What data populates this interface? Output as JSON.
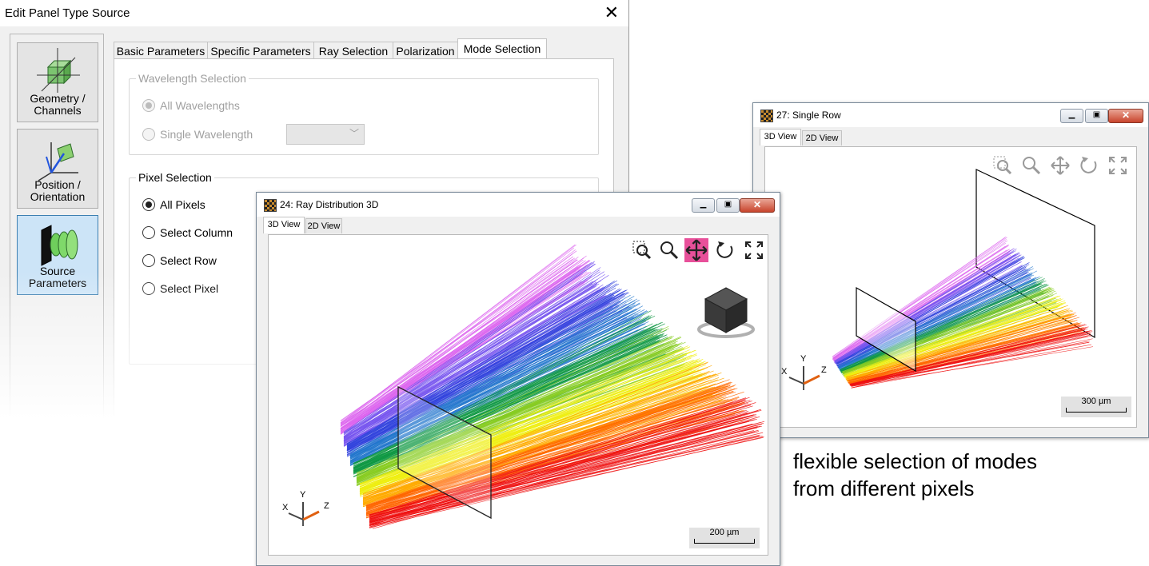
{
  "dialog": {
    "title": "Edit Panel Type Source",
    "close_glyph": "✕",
    "nav": [
      {
        "label": "Geometry / Channels",
        "icon": "geometry-icon"
      },
      {
        "label": "Position / Orientation",
        "icon": "position-orientation-icon"
      },
      {
        "label": "Source Parameters",
        "icon": "source-parameters-icon",
        "active": true
      }
    ],
    "tabs": [
      "Basic Parameters",
      "Specific Parameters",
      "Ray Selection",
      "Polarization",
      "Mode Selection"
    ],
    "active_tab": "Mode Selection",
    "wavelength_group": {
      "label": "Wavelength Selection",
      "options": [
        "All Wavelengths",
        "Single Wavelength"
      ],
      "selected": "All Wavelengths",
      "disabled": true
    },
    "pixel_group": {
      "label": "Pixel Selection",
      "options": [
        "All Pixels",
        "Select Column",
        "Select Row",
        "Select Pixel"
      ],
      "selected": "All Pixels"
    }
  },
  "view_main": {
    "title": "24: Ray Distribution 3D",
    "tabs": [
      "3D View",
      "2D View"
    ],
    "active_tab": "3D View",
    "scale": "200 µm",
    "axes": {
      "x": "X",
      "y": "Y",
      "z": "Z"
    }
  },
  "view_row": {
    "title": "27: Single Row",
    "tabs": [
      "3D View",
      "2D View"
    ],
    "active_tab": "3D View",
    "scale": "300 µm",
    "axes": {
      "x": "X",
      "y": "Y",
      "z": "Z"
    }
  },
  "caption": {
    "line1": "flexible selection of modes",
    "line2": "from different pixels"
  },
  "colors": {
    "accent_select": "#cce4f7",
    "pan_active": "#e8509a",
    "rays": [
      "#dd66ee",
      "#7755ee",
      "#3344dd",
      "#2277cc",
      "#119944",
      "#88cc22",
      "#eeee11",
      "#ffaa00",
      "#ff6600",
      "#ee1111"
    ]
  }
}
